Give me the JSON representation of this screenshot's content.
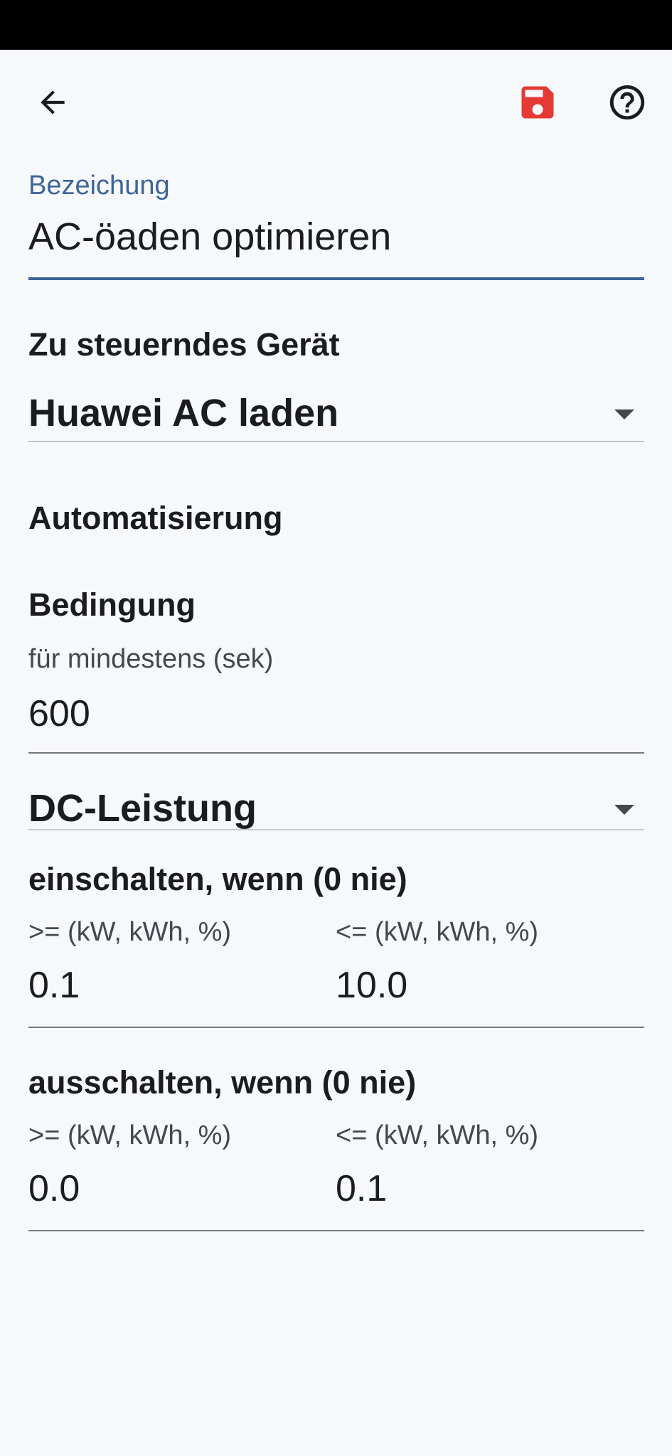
{
  "colors": {
    "background": "#f6f8fc",
    "accent": "#3d6596",
    "save_icon": "#e53935",
    "text": "#1b1c1f"
  },
  "toolbar": {
    "back_icon": "arrow-left-icon",
    "save_icon": "save-icon",
    "help_icon": "help-circle-icon"
  },
  "name_field": {
    "label": "Bezeichung",
    "value": "AC-öaden optimieren"
  },
  "device": {
    "heading": "Zu steuerndes Gerät",
    "selected": "Huawei AC laden"
  },
  "automation": {
    "heading": "Automatisierung",
    "condition_heading": "Bedingung",
    "duration_label": "für mindestens (sek)",
    "duration_value": "600",
    "source_selected": "DC-Leistung"
  },
  "switch_on": {
    "heading": "einschalten, wenn (0 nie)",
    "min_label": ">= (kW, kWh, %)",
    "min_value": "0.1",
    "max_label": "<= (kW, kWh, %)",
    "max_value": "10.0"
  },
  "switch_off": {
    "heading": "ausschalten, wenn (0 nie)",
    "min_label": ">= (kW, kWh, %)",
    "min_value": "0.0",
    "max_label": "<= (kW, kWh, %)",
    "max_value": "0.1"
  }
}
